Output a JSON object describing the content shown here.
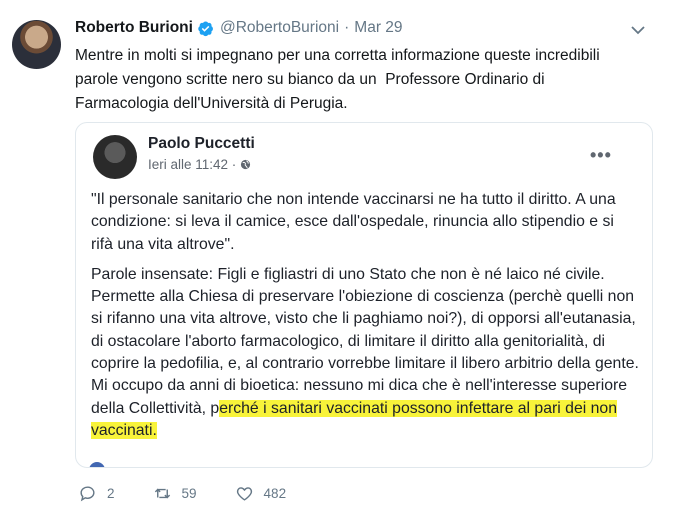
{
  "tweet": {
    "author_name": "Roberto Burioni",
    "handle": "@RobertoBurioni",
    "separator": "·",
    "date": "Mar 29",
    "text": "Mentre in molti si impegnano per una corretta informazione queste incredibili\nparole vengono scritte nero su bianco da un  Professore Ordinario di\nFarmacologia dell'Università di Perugia."
  },
  "quoted_post": {
    "author": "Paolo Puccetti",
    "time": "Ieri alle 11:42 ·",
    "more": "•••",
    "paragraph1": "\"Il personale sanitario che non intende vaccinarsi ne ha tutto il diritto. A una condizione: si leva il camice, esce dall'ospedale, rinuncia allo stipendio e si rifà una vita altrove\".",
    "paragraph2_plain": "Parole insensate: Figli e figliastri di uno Stato che non è né laico né civile.  Permette alla Chiesa di preservare l'obiezione di coscienza (perchè quelli non si rifanno una vita altrove, visto che li paghiamo noi?), di opporsi all'eutanasia, di ostacolare l'aborto farmacologico, di limitare il diritto alla genitorialità, di coprire la pedofilia, e, al contrario vorrebbe limitare il libero arbitrio della gente. Mi occupo da anni di bioetica: nessuno mi dica che è nell'interesse superiore della Collettività, p",
    "paragraph2_highlight": "erché i sanitari vaccinati possono infettare al pari dei non vaccinati."
  },
  "actions": {
    "replies": "2",
    "retweets": "59",
    "likes": "482"
  },
  "colors": {
    "verified": "#1da1f2",
    "highlight": "#f8f33a",
    "muted": "#657786"
  }
}
